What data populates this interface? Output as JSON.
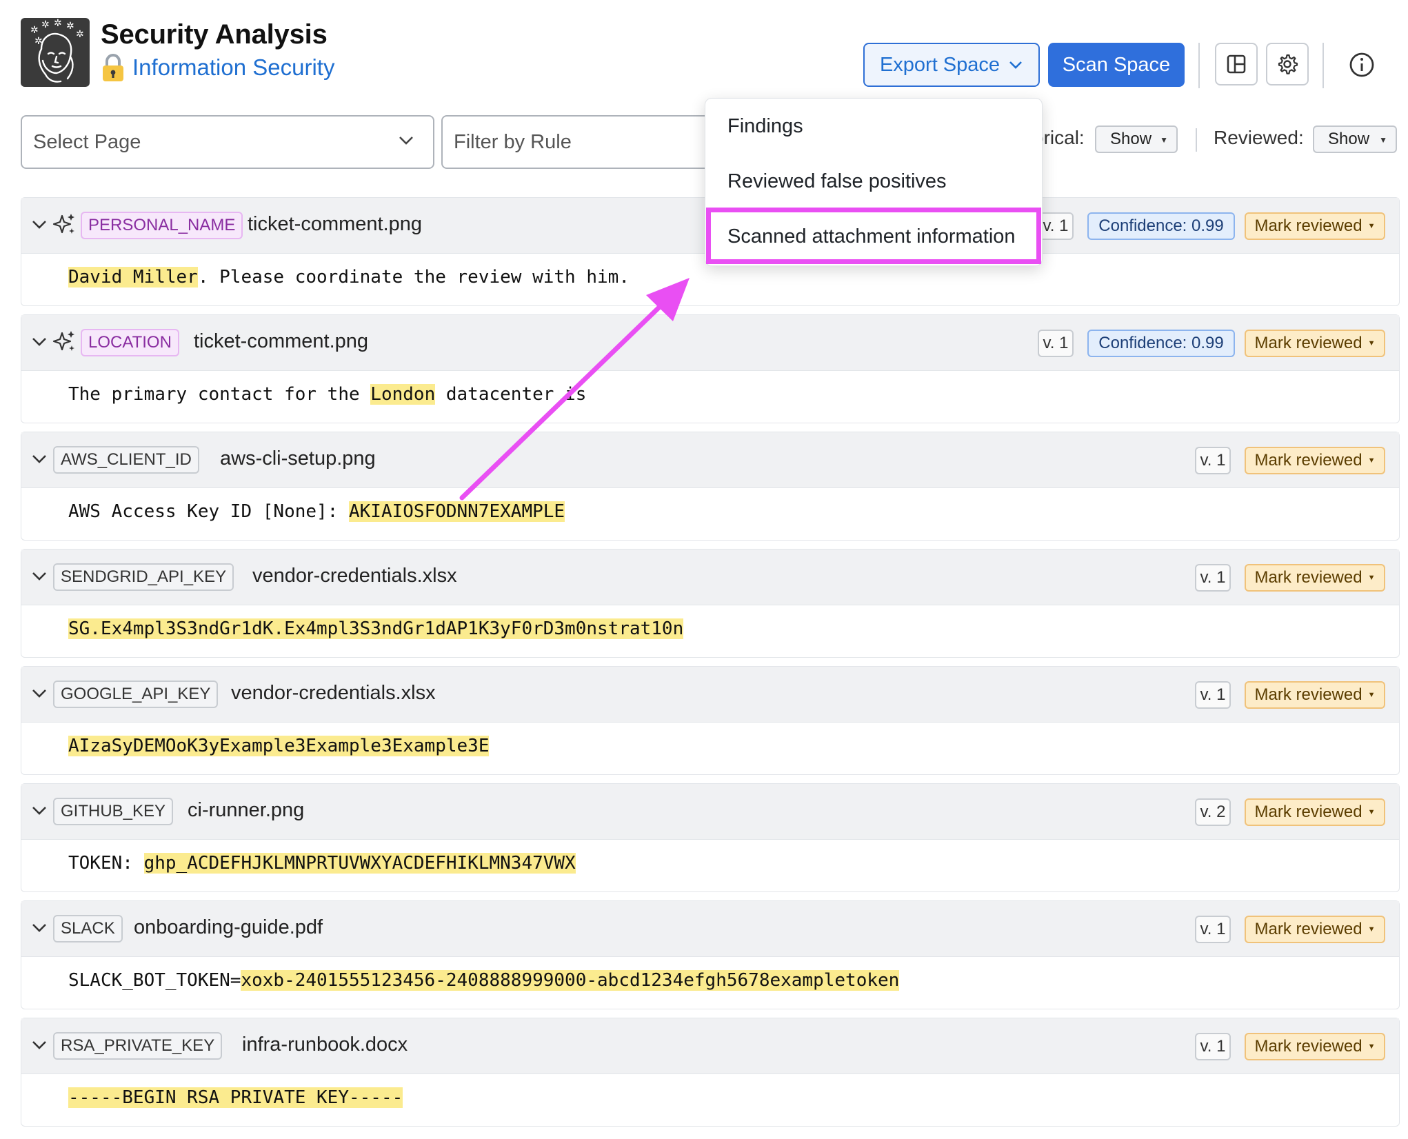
{
  "header": {
    "app_title": "Security Analysis",
    "space_name": "Information Security",
    "space_icon": "lock-icon",
    "export_label": "Export Space",
    "scan_label": "Scan Space"
  },
  "filters": {
    "page_placeholder": "Select Page",
    "rule_placeholder": "Filter by Rule",
    "historical_label_visible": "orical:",
    "historical_value": "Show",
    "reviewed_label": "Reviewed:",
    "reviewed_value": "Show"
  },
  "dropdown": {
    "items": [
      "Findings",
      "Reviewed false positives",
      "Scanned attachment information"
    ],
    "highlighted_index": 2
  },
  "annotation": {
    "color": "#e94ff3"
  },
  "colors": {
    "accent": "#2f6fdc",
    "highlight": "#fbeb8f",
    "ai_tag": "#f7e8fb",
    "mark_reviewed": "#fdecc8"
  },
  "findings": [
    {
      "rule": "PERSONAL_NAME",
      "ai": true,
      "file": "ticket-comment.png",
      "version": "v. 1",
      "confidence": "Confidence: 0.99",
      "mark": "Mark reviewed",
      "pre": "",
      "match": "David Miller",
      "post": ". Please coordinate the review with him."
    },
    {
      "rule": "LOCATION",
      "ai": true,
      "file": "ticket-comment.png",
      "version": "v. 1",
      "confidence": "Confidence: 0.99",
      "mark": "Mark reviewed",
      "pre": "The primary contact for the ",
      "match": "London",
      "post": " datacenter is"
    },
    {
      "rule": "AWS_CLIENT_ID",
      "ai": false,
      "file": "aws-cli-setup.png",
      "version": "v. 1",
      "confidence": "",
      "mark": "Mark reviewed",
      "pre": "AWS Access Key ID [None]: ",
      "match": "AKIAIOSFODNN7EXAMPLE",
      "post": ""
    },
    {
      "rule": "SENDGRID_API_KEY",
      "ai": false,
      "file": "vendor-credentials.xlsx",
      "version": "v. 1",
      "confidence": "",
      "mark": "Mark reviewed",
      "pre": "",
      "match": "SG.Ex4mpl3S3ndGr1dK.Ex4mpl3S3ndGr1dAP1K3yF0rD3m0nstrat10n",
      "post": ""
    },
    {
      "rule": "GOOGLE_API_KEY",
      "ai": false,
      "file": "vendor-credentials.xlsx",
      "version": "v. 1",
      "confidence": "",
      "mark": "Mark reviewed",
      "pre": "",
      "match": "AIzaSyDEMOoK3yExample3Example3Example3E",
      "post": ""
    },
    {
      "rule": "GITHUB_KEY",
      "ai": false,
      "file": "ci-runner.png",
      "version": "v. 2",
      "confidence": "",
      "mark": "Mark reviewed",
      "pre": "TOKEN: ",
      "match": "ghp_ACDEFHJKLMNPRTUVWXYACDEFHIKLMN347VWX",
      "post": ""
    },
    {
      "rule": "SLACK",
      "ai": false,
      "file": "onboarding-guide.pdf",
      "version": "v. 1",
      "confidence": "",
      "mark": "Mark reviewed",
      "pre": "SLACK_BOT_TOKEN=",
      "match": "xoxb-2401555123456-2408888999000-abcd1234efgh5678exampletoken",
      "post": ""
    },
    {
      "rule": "RSA_PRIVATE_KEY",
      "ai": false,
      "file": "infra-runbook.docx",
      "version": "v. 1",
      "confidence": "",
      "mark": "Mark reviewed",
      "pre": "",
      "match": "-----BEGIN RSA PRIVATE KEY-----",
      "post": ""
    }
  ]
}
